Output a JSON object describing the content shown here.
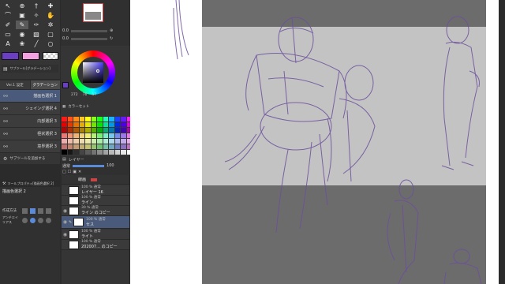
{
  "tools": [
    {
      "icon": "pointer-icon",
      "glyph": "↖"
    },
    {
      "icon": "zoom-icon",
      "glyph": "⊕"
    },
    {
      "icon": "eyedropper-icon",
      "glyph": "†"
    },
    {
      "icon": "move-icon",
      "glyph": "✚"
    },
    {
      "icon": "lasso-icon",
      "glyph": "⌒"
    },
    {
      "icon": "select-icon",
      "glyph": "▣"
    },
    {
      "icon": "magic-wand-icon",
      "glyph": "✧"
    },
    {
      "icon": "hand-icon",
      "glyph": "✋"
    },
    {
      "icon": "pen-icon",
      "glyph": "✐"
    },
    {
      "icon": "pencil-icon",
      "glyph": "✎",
      "selected": true
    },
    {
      "icon": "brush-icon",
      "glyph": "✑"
    },
    {
      "icon": "airbrush-icon",
      "glyph": "✲"
    },
    {
      "icon": "eraser-icon",
      "glyph": "▭"
    },
    {
      "icon": "fill-icon",
      "glyph": "◉"
    },
    {
      "icon": "gradient-icon",
      "glyph": "▧"
    },
    {
      "icon": "shape-icon",
      "glyph": "▢"
    },
    {
      "icon": "text-icon",
      "glyph": "A"
    },
    {
      "icon": "blend-icon",
      "glyph": "❀"
    },
    {
      "icon": "ruler-icon",
      "glyph": "╱"
    },
    {
      "icon": "balloon-icon",
      "glyph": "○"
    }
  ],
  "colors": {
    "main": "#6a3fc4",
    "sub": "#f5a0e0",
    "accent": "#4a5a7a"
  },
  "subtool": {
    "header_label": "サブツール[グラデーション]",
    "tabs": [
      "Ver.1 設定",
      "グラデーション"
    ],
    "items": [
      "描画色選択 1",
      "シェイング選択 4",
      "内部選択 3",
      "極状選択 3",
      "境界選択 3"
    ],
    "add_label": "サブツールを追加する"
  },
  "tool_property": {
    "title": "ツールプロパティ[描画色選択 2]",
    "item": "描画色選択 2",
    "mode_label": "作成方法",
    "aa_label": "アンチエイリアス"
  },
  "navigator": {
    "zoom": "0.0",
    "angle": "0.0"
  },
  "color_panel": {
    "values": [
      "272",
      "76",
      "57"
    ]
  },
  "color_set": {
    "title": "カラーセット"
  },
  "layers": {
    "panel_title": "レイヤー",
    "blend_mode": "通常",
    "opacity": "100",
    "header_label": "線画",
    "items": [
      {
        "blend": "100 % 通常",
        "name": "レイヤー 16"
      },
      {
        "blend": "100 % 通常",
        "name": "ライン"
      },
      {
        "blend": "30 % 通常",
        "name": "ライン のコピー"
      },
      {
        "blend": "100 % 通常",
        "name": "セス",
        "active": true
      },
      {
        "blend": "100 % 通常",
        "name": "ライト"
      },
      {
        "blend": "100 % 通常",
        "name": "202007… のコピー"
      }
    ]
  }
}
